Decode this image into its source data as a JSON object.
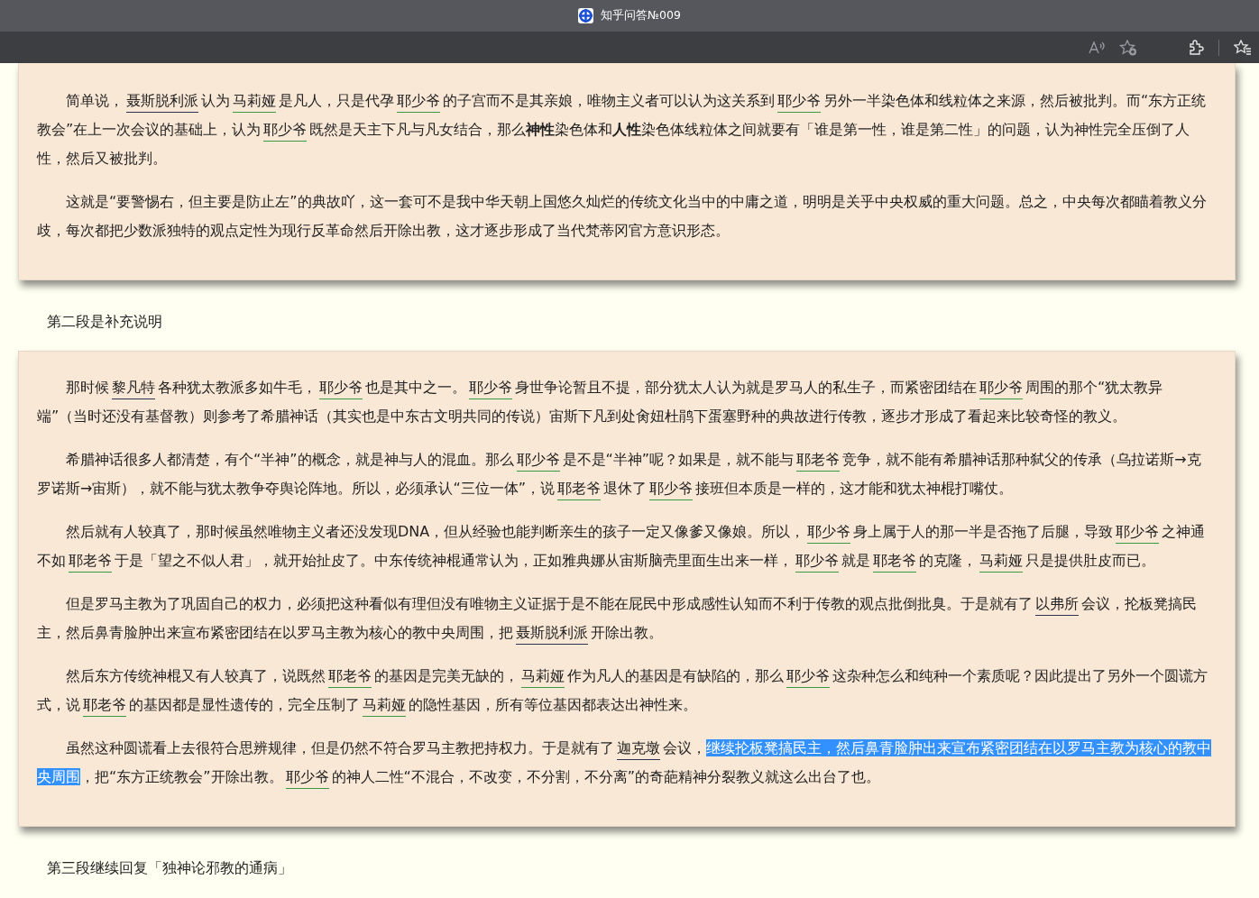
{
  "browser": {
    "title": "知乎问答№009"
  },
  "sections": [
    {
      "kind": "card",
      "paragraphs": [
        [
          {
            "kind": "text",
            "text": "简单说，"
          },
          {
            "kind": "link",
            "text": "聂斯脱利派",
            "color": "#2b3550"
          },
          {
            "kind": "text",
            "text": "认为"
          },
          {
            "kind": "link",
            "text": "马莉娅",
            "color": "#3c9a3c"
          },
          {
            "kind": "text",
            "text": "是凡人，只是代孕"
          },
          {
            "kind": "link",
            "text": "耶少爷",
            "color": "#3c9a3c"
          },
          {
            "kind": "text",
            "text": "的子宫而不是其亲娘，唯物主义者可以认为这关系到"
          },
          {
            "kind": "link",
            "text": "耶少爷",
            "color": "#3c9a3c"
          },
          {
            "kind": "text",
            "text": "另外一半染色体和线粒体之来源，然后被批判。而“东方正统教会”在上一次会议的基础上，认为"
          },
          {
            "kind": "link",
            "text": "耶少爷",
            "color": "#3c9a3c"
          },
          {
            "kind": "text",
            "text": "既然是天主下凡与凡女结合，那么**神性**染色体和**人性**染色体线粒体之间就要有「谁是第一性，谁是第二性」的问题，认为神性完全压倒了人性，然后又被批判。"
          }
        ],
        [
          {
            "kind": "text",
            "text": "这就是“要警惕右，但主要是防止左”的典故吖，这一套可不是我中华天朝上国悠久灿烂的传统文化当中的中庸之道，明明是关乎中央权威的重大问题。总之，中央每次都瞄着教义分歧，每次都把少数派独特的观点定性为现行反革命然后开除出教，这才逐步形成了当代梵蒂冈官方意识形态。"
          }
        ]
      ]
    },
    {
      "kind": "heading",
      "text": "第二段是补充说明"
    },
    {
      "kind": "card",
      "paragraphs": [
        [
          {
            "kind": "text",
            "text": "那时候"
          },
          {
            "kind": "link",
            "text": "黎凡特",
            "color": "#2b3550"
          },
          {
            "kind": "text",
            "text": "各种犹太教派多如牛毛，"
          },
          {
            "kind": "link",
            "text": "耶少爷",
            "color": "#3c9a3c"
          },
          {
            "kind": "text",
            "text": "也是其中之一。"
          },
          {
            "kind": "link",
            "text": "耶少爷",
            "color": "#3c9a3c"
          },
          {
            "kind": "text",
            "text": "身世争论暂且不提，部分犹太人认为就是罗马人的私生子，而紧密团结在"
          },
          {
            "kind": "link",
            "text": "耶少爷",
            "color": "#3c9a3c"
          },
          {
            "kind": "text",
            "text": "周围的那个“犹太教异端”（当时还没有基督教）则参考了希腊神话（其实也是中东古文明共同的传说）宙斯下凡到处肏妞杜鹃下蛋塞野种的典故进行传教，逐步才形成了看起来比较奇怪的教义。"
          }
        ],
        [
          {
            "kind": "text",
            "text": "希腊神话很多人都清楚，有个“半神”的概念，就是神与人的混血。那么"
          },
          {
            "kind": "link",
            "text": "耶少爷",
            "color": "#3c9a3c"
          },
          {
            "kind": "text",
            "text": "是不是“半神”呢？如果是，就不能与"
          },
          {
            "kind": "link",
            "text": "耶老爷",
            "color": "#3c9a3c"
          },
          {
            "kind": "text",
            "text": "竞争，就不能有希腊神话那种弑父的传承（乌拉诺斯→克罗诺斯→宙斯），就不能与犹太教争夺舆论阵地。所以，必须承认“三位一体”，说"
          },
          {
            "kind": "link",
            "text": "耶老爷",
            "color": "#3c9a3c"
          },
          {
            "kind": "text",
            "text": "退休了"
          },
          {
            "kind": "link",
            "text": "耶少爷",
            "color": "#3c9a3c"
          },
          {
            "kind": "text",
            "text": "接班但本质是一样的，这才能和犹太神棍打嘴仗。"
          }
        ],
        [
          {
            "kind": "text",
            "text": "然后就有人较真了，那时候虽然唯物主义者还没发现DNA，但从经验也能判断亲生的孩子一定又像爹又像娘。所以，"
          },
          {
            "kind": "link",
            "text": "耶少爷",
            "color": "#3c9a3c"
          },
          {
            "kind": "text",
            "text": "身上属于人的那一半是否拖了后腿，导致"
          },
          {
            "kind": "link",
            "text": "耶少爷",
            "color": "#3c9a3c"
          },
          {
            "kind": "text",
            "text": "之神通不如"
          },
          {
            "kind": "link",
            "text": "耶老爷",
            "color": "#3c9a3c"
          },
          {
            "kind": "text",
            "text": "于是「望之不似人君」，就开始扯皮了。中东传统神棍通常认为，正如雅典娜从宙斯脑壳里面生出来一样，"
          },
          {
            "kind": "link",
            "text": "耶少爷",
            "color": "#3c9a3c"
          },
          {
            "kind": "text",
            "text": "就是"
          },
          {
            "kind": "link",
            "text": "耶老爷",
            "color": "#3c9a3c"
          },
          {
            "kind": "text",
            "text": "的克隆，"
          },
          {
            "kind": "link",
            "text": "马莉娅",
            "color": "#3c9a3c"
          },
          {
            "kind": "text",
            "text": "只是提供肚皮而已。"
          }
        ],
        [
          {
            "kind": "text",
            "text": "但是罗马主教为了巩固自己的权力，必须把这种看似有理但没有唯物主义证据于是不能在屁民中形成感性认知而不利于传教的观点批倒批臭。于是就有了"
          },
          {
            "kind": "link",
            "text": "以弗所",
            "color": "#2b3550"
          },
          {
            "kind": "text",
            "text": "会议，抡板凳搞民主，然后鼻青脸肿出来宣布紧密团结在以罗马主教为核心的教中央周围，把"
          },
          {
            "kind": "link",
            "text": "聂斯脱利派",
            "color": "#2b3550"
          },
          {
            "kind": "text",
            "text": "开除出教。"
          }
        ],
        [
          {
            "kind": "text",
            "text": "然后东方传统神棍又有人较真了，说既然"
          },
          {
            "kind": "link",
            "text": "耶老爷",
            "color": "#3c9a3c"
          },
          {
            "kind": "text",
            "text": "的基因是完美无缺的，"
          },
          {
            "kind": "link",
            "text": "马莉娅",
            "color": "#3c9a3c"
          },
          {
            "kind": "text",
            "text": "作为凡人的基因是有缺陷的，那么"
          },
          {
            "kind": "link",
            "text": "耶少爷",
            "color": "#3c9a3c"
          },
          {
            "kind": "text",
            "text": "这杂种怎么和纯种一个素质呢？因此提出了另外一个圆谎方式，说"
          },
          {
            "kind": "link",
            "text": "耶老爷",
            "color": "#3c9a3c"
          },
          {
            "kind": "text",
            "text": "的基因都是显性遗传的，完全压制了"
          },
          {
            "kind": "link",
            "text": "马莉娅",
            "color": "#3c9a3c"
          },
          {
            "kind": "text",
            "text": "的隐性基因，所有等位基因都表达出神性来。"
          }
        ],
        [
          {
            "kind": "text",
            "text": "虽然这种圆谎看上去很符合思辨规律，但是仍然不符合罗马主教把持权力。于是就有了"
          },
          {
            "kind": "link",
            "text": "迦克墩",
            "color": "#2b3550"
          },
          {
            "kind": "text",
            "text": "会议，"
          },
          {
            "kind": "highlight",
            "text": "继续抡板凳搞民主，然后鼻青脸肿出来宣布紧密团结在以罗马主教为核心的教中央周围"
          },
          {
            "kind": "text",
            "text": "，把“东方正统教会”开除出教。"
          },
          {
            "kind": "link",
            "text": "耶少爷",
            "color": "#3c9a3c"
          },
          {
            "kind": "text",
            "text": "的神人二性“不混合，不改变，不分割，不分离”的奇葩精神分裂教义就这么出台了也。"
          }
        ]
      ]
    },
    {
      "kind": "heading",
      "text": "第三段继续回复「独神论邪教的通病」"
    }
  ]
}
